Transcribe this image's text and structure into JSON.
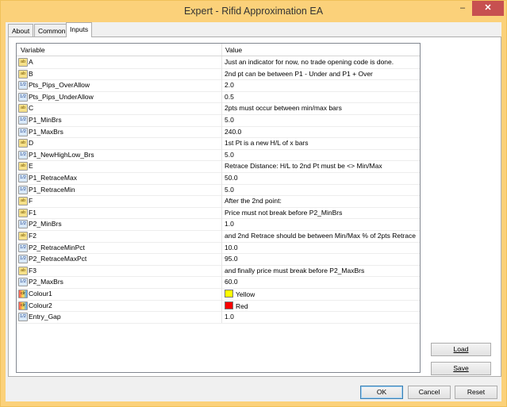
{
  "window": {
    "title": "Expert - Rifid Approximation EA",
    "minimize_glyph": "–",
    "close_glyph": "✕"
  },
  "tabs": [
    {
      "label": "About"
    },
    {
      "label": "Common"
    },
    {
      "label": "Inputs"
    }
  ],
  "active_tab": "Inputs",
  "grid": {
    "headers": {
      "variable": "Variable",
      "value": "Value"
    },
    "rows": [
      {
        "type": "string",
        "icon_text": "ab",
        "name": "A",
        "value": "Just an indicator for now, no trade opening code is done."
      },
      {
        "type": "string",
        "icon_text": "ab",
        "name": "B",
        "value": "2nd pt can be between P1 - Under and P1 + Over"
      },
      {
        "type": "number",
        "icon_text": "1/2",
        "name": "Pts_Pips_OverAllow",
        "value": "2.0"
      },
      {
        "type": "number",
        "icon_text": "1/2",
        "name": "Pts_Pips_UnderAllow",
        "value": "0.5"
      },
      {
        "type": "string",
        "icon_text": "ab",
        "name": "C",
        "value": "2pts must occur between min/max bars"
      },
      {
        "type": "number",
        "icon_text": "1/2",
        "name": "P1_MinBrs",
        "value": "5.0"
      },
      {
        "type": "number",
        "icon_text": "1/2",
        "name": "P1_MaxBrs",
        "value": "240.0"
      },
      {
        "type": "string",
        "icon_text": "ab",
        "name": "D",
        "value": "1st Pt is a new H/L of x bars"
      },
      {
        "type": "number",
        "icon_text": "1/2",
        "name": "P1_NewHighLow_Brs",
        "value": "5.0"
      },
      {
        "type": "string",
        "icon_text": "ab",
        "name": "E",
        "value": "Retrace Distance: H/L to 2nd Pt must be <> Min/Max"
      },
      {
        "type": "number",
        "icon_text": "1/2",
        "name": "P1_RetraceMax",
        "value": "50.0"
      },
      {
        "type": "number",
        "icon_text": "1/2",
        "name": "P1_RetraceMin",
        "value": "5.0"
      },
      {
        "type": "string",
        "icon_text": "ab",
        "name": "F",
        "value": "After the 2nd point:"
      },
      {
        "type": "string",
        "icon_text": "ab",
        "name": "F1",
        "value": "Price must not break before P2_MinBrs"
      },
      {
        "type": "number",
        "icon_text": "1/2",
        "name": "P2_MinBrs",
        "value": "1.0"
      },
      {
        "type": "string",
        "icon_text": "ab",
        "name": "F2",
        "value": "and 2nd Retrace should be between Min/Max % of 2pts Retrace"
      },
      {
        "type": "number",
        "icon_text": "1/2",
        "name": "P2_RetraceMinPct",
        "value": "10.0"
      },
      {
        "type": "number",
        "icon_text": "1/2",
        "name": "P2_RetraceMaxPct",
        "value": "95.0"
      },
      {
        "type": "string",
        "icon_text": "ab",
        "name": "F3",
        "value": "and finally price must break before P2_MaxBrs"
      },
      {
        "type": "number",
        "icon_text": "1/2",
        "name": "P2_MaxBrs",
        "value": "60.0"
      },
      {
        "type": "color",
        "icon_text": "clr",
        "name": "Colour1",
        "value": "Yellow",
        "swatch": "#ffff00"
      },
      {
        "type": "color",
        "icon_text": "clr",
        "name": "Colour2",
        "value": "Red",
        "swatch": "#ff0000"
      },
      {
        "type": "number",
        "icon_text": "1/2",
        "name": "Entry_Gap",
        "value": "1.0"
      }
    ]
  },
  "side_buttons": {
    "load_label": "Load",
    "save_label": "Save"
  },
  "footer_buttons": {
    "ok_label": "OK",
    "cancel_label": "Cancel",
    "reset_label": "Reset"
  },
  "colors": {
    "title_bar": "#fbd17a",
    "close_button": "#c75050",
    "default_button_border": "#3c7fb1"
  }
}
